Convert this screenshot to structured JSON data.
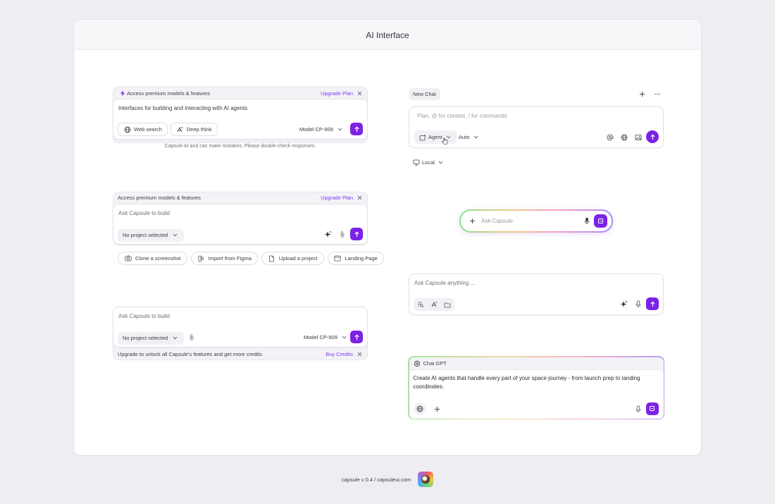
{
  "frame": {
    "title": "AI Interface"
  },
  "card1": {
    "banner": "Access premium models & features",
    "upgrade": "Upgrade Plan",
    "prompt": "Interfaces for building and interacting with AI agents",
    "web_search": "Web search",
    "deep_think": "Deep think",
    "model": "Model CP-909",
    "disclaimer": "Capsule AI and can make mistakes. Please double-check responses."
  },
  "card2": {
    "banner": "Access premium models & features",
    "upgrade": "Upgrade Plan",
    "placeholder": "Ask Capsule to build",
    "project": "No project selected",
    "chips": [
      "Clone a screenshot",
      "Import from Figma",
      "Upload a project",
      "Landing Page"
    ]
  },
  "card3": {
    "placeholder": "Ask Capsule to build",
    "project": "No project selected",
    "model": "Model CP-909",
    "banner": "Upgrade to unlock all Capsule's features and get more credits",
    "buy": "Buy Credits"
  },
  "card4": {
    "tab": "New Chat",
    "placeholder": "Plan, @ for context, / for commands",
    "agent": "Agent",
    "auto": "Auto",
    "local": "Local"
  },
  "card5": {
    "placeholder": "Ask Capsule"
  },
  "card6": {
    "placeholder": "Ask Capsule anything ..."
  },
  "card7": {
    "label": "Chat GPT",
    "text": "Create AI agents that handle every part of your space journey - from launch prep to landing coordinates."
  },
  "footer": {
    "text": "capsule v 0.4 / capsuleui.com"
  },
  "colors": {
    "accent": "#7c22e8",
    "link": "#7c3aed",
    "background": "#eeeef2"
  }
}
